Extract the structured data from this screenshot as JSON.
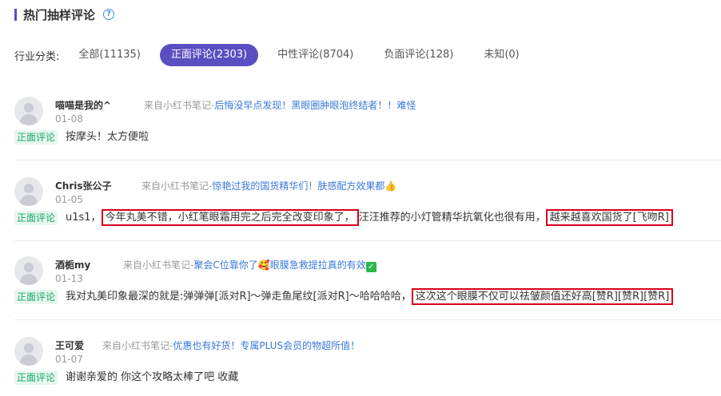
{
  "header": {
    "title": "热门抽样评论",
    "help_icon": "question-circle-icon"
  },
  "filters": {
    "label": "行业分类:",
    "options": [
      {
        "label": "全部(11135)",
        "active": false
      },
      {
        "label": "正面评论(2303)",
        "active": true
      },
      {
        "label": "中性评论(8704)",
        "active": false
      },
      {
        "label": "负面评论(128)",
        "active": false
      },
      {
        "label": "未知(0)",
        "active": false
      }
    ]
  },
  "reviews": [
    {
      "user": "喵喵是我的^",
      "source_prefix": "来自小红书笔记-",
      "source_title": "后悔没早点发现！黑眼圈肿眼泡终结者！！难怪",
      "date": "01-08",
      "tag": "正面评论",
      "text": "按摩头！太方便啦"
    },
    {
      "user": "Chris张公子",
      "source_prefix": "来自小红书笔记-",
      "source_title": "惊艳过我的国货精华们！肤感配方效果都",
      "source_emoji": "👍",
      "date": "01-05",
      "tag": "正面评论",
      "text_a": "u1s1，",
      "text_hl1": "今年丸美不错，小红笔眼霜用完之后完全改变印象了，",
      "text_b": "汪汪推荐的小灯管精华抗氧化也很有用，",
      "text_hl2": "越来越喜欢国货了[飞吻R]"
    },
    {
      "user": "酒栀my",
      "source_prefix": "来自小红书笔记-",
      "source_title_a": "聚会C位靠你了",
      "source_emoji": "🥰",
      "source_title_b": "眼膜急救提拉真的有效",
      "source_check": "✓",
      "date": "01-13",
      "tag": "正面评论",
      "text_a": "我对丸美印象最深的就是:弹弹弹[派对R]～弹走鱼尾纹[派对R]～哈哈哈哈，",
      "text_hl1": "这次这个眼膜不仅可以祛皱颜值还好高[赞R][赞R][赞R]"
    },
    {
      "user": "王可爱",
      "source_prefix": "来自小红书笔记-",
      "source_title": "优惠也有好货！专属PLUS会员的物超所值！",
      "date": "01-07",
      "tag": "正面评论",
      "text": "谢谢亲爱的 你这个攻略太棒了吧 收藏"
    }
  ]
}
